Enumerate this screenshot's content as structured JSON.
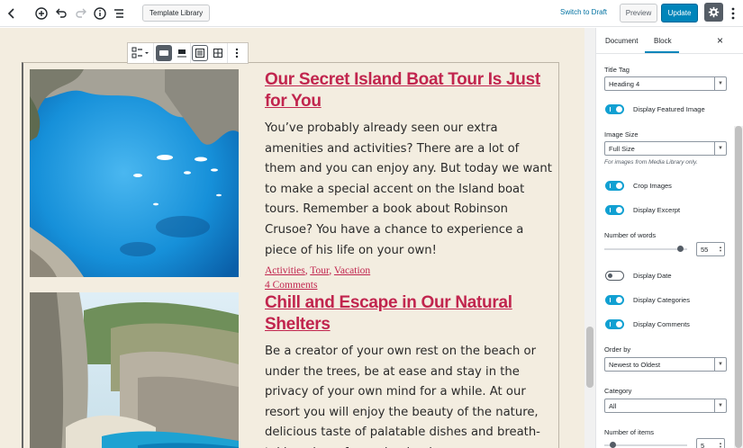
{
  "toolbar": {
    "template_library": "Template Library",
    "switch_to_draft": "Switch to Draft",
    "preview": "Preview",
    "update": "Update",
    "icons": [
      "back-icon",
      "add-block-icon",
      "undo-icon",
      "redo-icon",
      "info-icon",
      "outline-icon",
      "gear-icon",
      "more-vertical-icon"
    ]
  },
  "posts": [
    {
      "title": "Our Secret Island Boat Tour Is Just for You",
      "excerpt": "You’ve probably already seen our extra amenities and activities? There are a lot of them and you can enjoy any. But today we want to make a special accent on the Island boat tours. Remember a book about Robinson Crusoe? You have a chance to experience a piece of his life on your own!",
      "categories": [
        "Activities",
        "Tour",
        "Vacation"
      ],
      "comments": "4 Comments"
    },
    {
      "title": "Chill and Escape in Our Natural Shelters",
      "excerpt": "Be a creator of your own rest on the beach or under the trees, be at ease and stay in the privacy of your own mind for a while. At our resort you will enjoy the beauty of the nature, delicious taste of palatable dishes and breath-taking view of amazing landscapes."
    }
  ],
  "sidebar": {
    "tab_document": "Document",
    "tab_block": "Block",
    "close": "×",
    "title_tag_label": "Title Tag",
    "title_tag_value": "Heading 4",
    "display_featured_image": "Display Featured Image",
    "image_size_label": "Image Size",
    "image_size_value": "Full Size",
    "image_size_help": "For images from Media Library only.",
    "crop_images": "Crop Images",
    "display_excerpt": "Display Excerpt",
    "number_of_words_label": "Number of words",
    "number_of_words_value": "55",
    "number_of_words_fraction": 0.92,
    "display_date": "Display Date",
    "display_categories": "Display Categories",
    "display_comments": "Display Comments",
    "order_by_label": "Order by",
    "order_by_value": "Newest to Oldest",
    "category_label": "Category",
    "category_value": "All",
    "number_of_items_label": "Number of items",
    "number_of_items_value": "5",
    "toggles": {
      "featured_image": true,
      "crop_images": true,
      "excerpt": true,
      "date": false,
      "categories": true,
      "comments": true
    }
  },
  "colors": {
    "accent": "#0085ba",
    "title": "#c1254e",
    "editor_bg": "#f3ede0",
    "toggle_on": "#11a0d2"
  }
}
